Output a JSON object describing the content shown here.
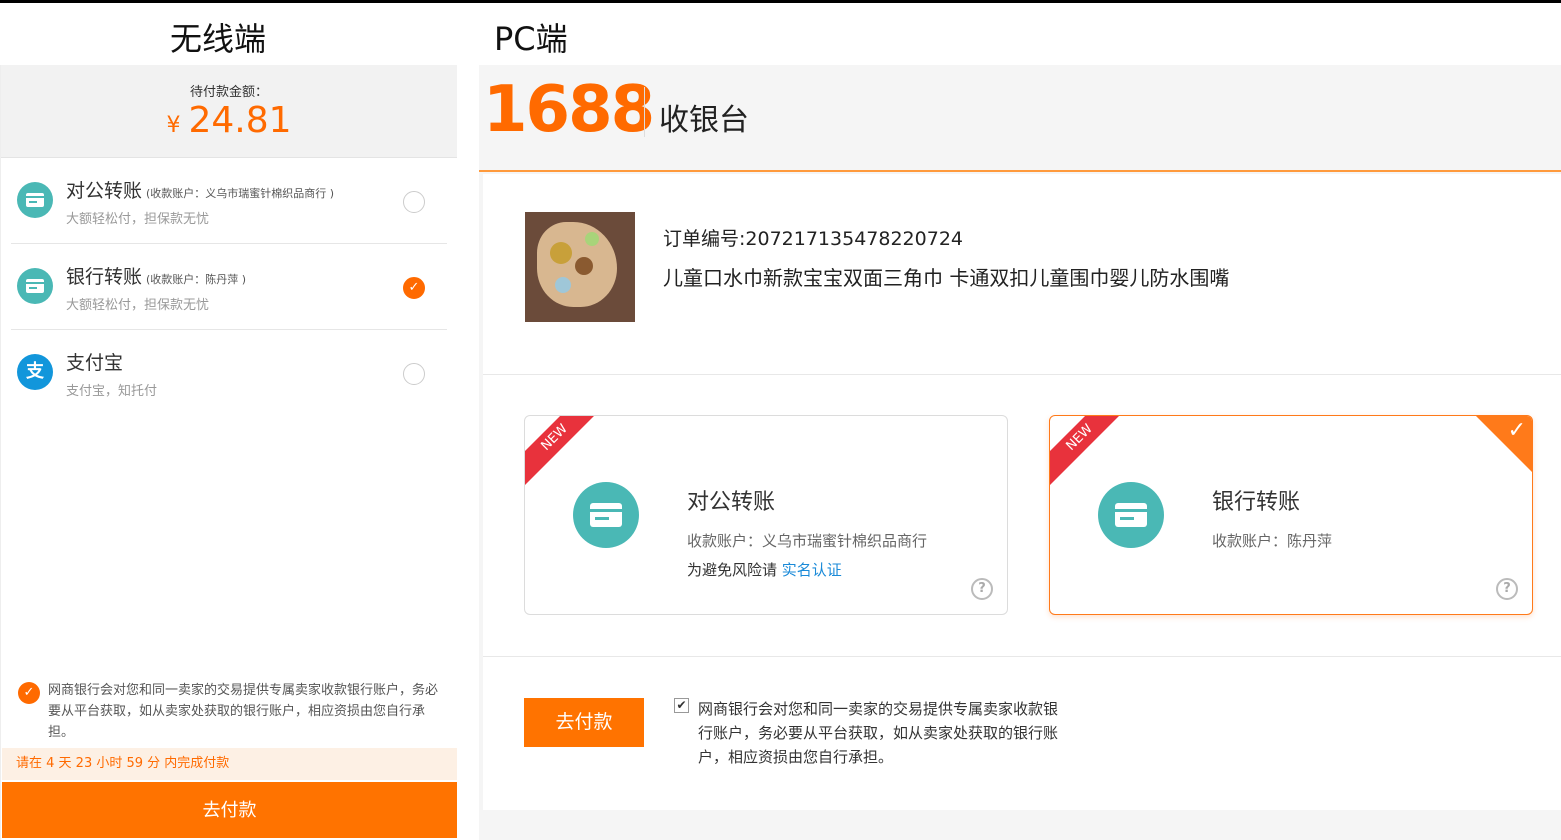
{
  "labels": {
    "mobile": "无线端",
    "pc": "PC端"
  },
  "mobile": {
    "amount_label": "待付款金额：",
    "currency": "¥",
    "amount": "24.81",
    "options": [
      {
        "title": "对公转账",
        "account": "(收款账户：义乌市瑞蜜针棉织品商行 )",
        "sub": "大额轻松付，担保款无忧",
        "selected": false,
        "icon": "card-icon"
      },
      {
        "title": "银行转账",
        "account": "(收款账户：陈丹萍 )",
        "sub": "大额轻松付，担保款无忧",
        "selected": true,
        "icon": "card-icon"
      },
      {
        "title": "支付宝",
        "account": "",
        "sub": "支付宝，知托付",
        "selected": false,
        "icon": "alipay-icon",
        "icon_glyph": "支"
      }
    ],
    "agreement": "网商银行会对您和同一卖家的交易提供专属卖家收款银行账户，务必要从平台获取，如从卖家处获取的银行账户，相应资损由您自行承担。",
    "deadline": "请在 4 天 23 小时 59 分 内完成付款",
    "pay_button": "去付款"
  },
  "pc": {
    "logo": "1688",
    "cashier": "收银台",
    "order_no": "订单编号:207217135478220724",
    "product_title": "儿童口水巾新款宝宝双面三角巾 卡通双扣儿童围巾婴儿防水围嘴",
    "cards": [
      {
        "badge": "NEW",
        "title": "对公转账",
        "account": "收款账户：义乌市瑞蜜针棉织品商行",
        "risk_prefix": "为避免风险请 ",
        "risk_link": "实名认证",
        "selected": false,
        "help": "?"
      },
      {
        "badge": "NEW",
        "title": "银行转账",
        "account": "收款账户：陈丹萍",
        "selected": true,
        "help": "?"
      }
    ],
    "pay_button": "去付款",
    "agreement": "网商银行会对您和同一卖家的交易提供专属卖家收款银行账户，务必要从平台获取，如从卖家处获取的银行账户，相应资损由您自行承担。",
    "agreement_checked": true
  },
  "colors": {
    "accent": "#ff6a00",
    "teal": "#4ab8b5",
    "alipay": "#1296db",
    "link": "#1a8ad8",
    "ribbon": "#e8323c"
  }
}
